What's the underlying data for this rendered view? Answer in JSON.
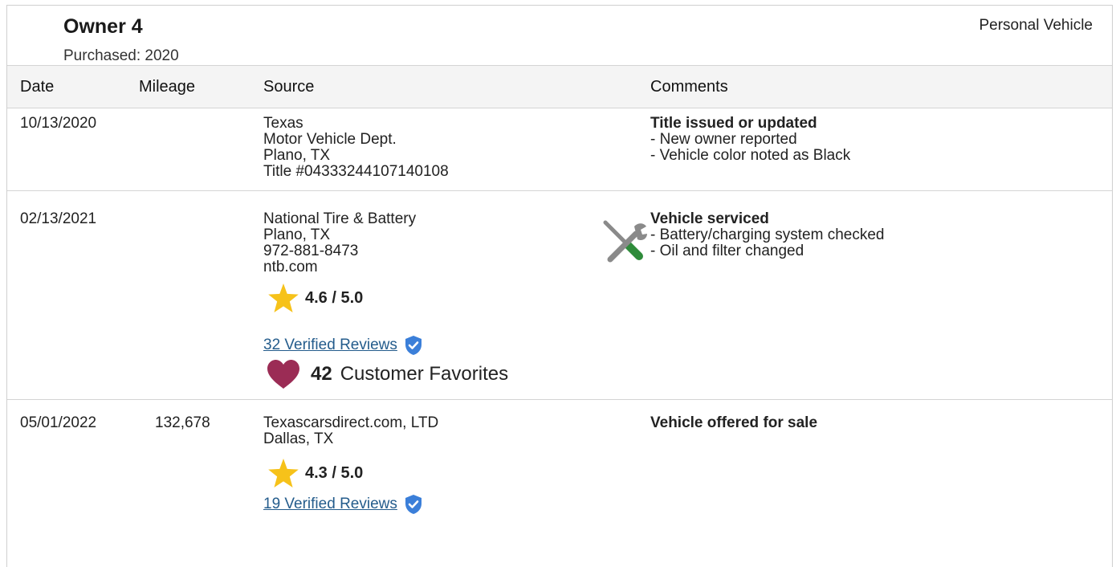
{
  "owner": {
    "title": "Owner 4",
    "purchased": "Purchased: 2020",
    "vehicle_type": "Personal Vehicle"
  },
  "columns": {
    "date": "Date",
    "mileage": "Mileage",
    "source": "Source",
    "comments": "Comments"
  },
  "rows": [
    {
      "date": "10/13/2020",
      "mileage": "",
      "source": [
        "Texas",
        "Motor Vehicle Dept.",
        "Plano, TX",
        "Title #04333244107140108"
      ],
      "comment_title": "Title issued or updated",
      "comments": [
        "- New owner reported",
        "- Vehicle color noted as Black"
      ]
    },
    {
      "date": "02/13/2021",
      "mileage": "",
      "source": [
        "National Tire & Battery",
        "Plano, TX",
        "972-881-8473",
        "ntb.com"
      ],
      "rating": "4.6 / 5.0",
      "reviews": "32 Verified Reviews",
      "favorites_count": "42",
      "favorites_label": "Customer Favorites",
      "comment_title": "Vehicle serviced",
      "comments": [
        "- Battery/charging system checked",
        "- Oil and filter changed"
      ],
      "icon": "service-tools-icon"
    },
    {
      "date": "05/01/2022",
      "mileage": "132,678",
      "source": [
        "Texascarsdirect.com, LTD",
        "Dallas, TX"
      ],
      "rating": "4.3 / 5.0",
      "reviews": "19 Verified Reviews",
      "comment_title": "Vehicle offered for sale",
      "comments": []
    }
  ],
  "colors": {
    "star": "#f6c21a",
    "heart": "#9b2c55",
    "verified": "#3b7fd9",
    "link": "#245c8c",
    "wrench_handle": "#2e8b3a"
  }
}
